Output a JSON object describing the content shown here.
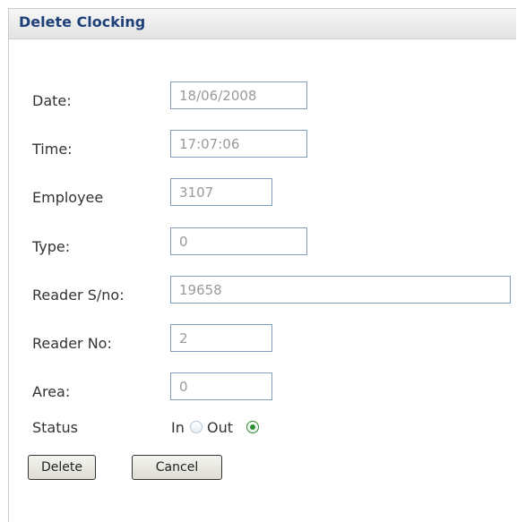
{
  "dialog": {
    "title": "Delete Clocking"
  },
  "form": {
    "date": {
      "label": "Date:",
      "value": "18/06/2008"
    },
    "time": {
      "label": "Time:",
      "value": "17:07:06"
    },
    "employee": {
      "label": "Employee",
      "value": "3107"
    },
    "type": {
      "label": "Type:",
      "value": "0"
    },
    "reader_sno": {
      "label": "Reader S/no:",
      "value": "19658"
    },
    "reader_no": {
      "label": "Reader No:",
      "value": "2"
    },
    "area": {
      "label": "Area:",
      "value": "0"
    },
    "status": {
      "label": "Status",
      "options": [
        {
          "label": "In",
          "checked": false
        },
        {
          "label": "Out",
          "checked": true
        }
      ]
    }
  },
  "buttons": {
    "delete_label": "Delete",
    "cancel_label": "Cancel"
  },
  "colors": {
    "title_text": "#1f3f78",
    "field_border": "#7f9db9",
    "field_text": "#9a9a9a",
    "radio_checked": "#2d8f2d"
  }
}
